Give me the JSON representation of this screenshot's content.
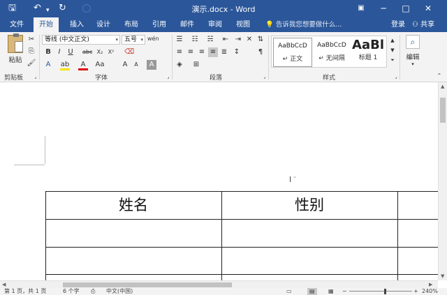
{
  "window": {
    "title": "演示.docx - Word"
  },
  "quick_access": {
    "save_icon": "save-icon",
    "undo_icon": "undo-icon",
    "redo_icon": "redo-icon"
  },
  "tabs": [
    "文件",
    "开始",
    "插入",
    "设计",
    "布局",
    "引用",
    "邮件",
    "审阅",
    "视图"
  ],
  "active_tab": "开始",
  "tell_me": "告诉我您想要做什么...",
  "account": {
    "login": "登录",
    "share": "共享"
  },
  "ribbon": {
    "clipboard": {
      "paste": "粘贴",
      "group": "剪贴板"
    },
    "font": {
      "name": "等线 (中文正文)",
      "size": "五号",
      "group": "字体",
      "buttons": [
        "B",
        "I",
        "U",
        "abc",
        "X₂",
        "X²",
        "A",
        "A",
        "Aa",
        "A",
        "A",
        "A"
      ]
    },
    "paragraph": {
      "group": "段落"
    },
    "styles": {
      "group": "样式",
      "items": [
        {
          "preview": "AaBbCcD",
          "name": "↵ 正文"
        },
        {
          "preview": "AaBbCcD",
          "name": "↵ 无间隔"
        },
        {
          "preview": "AaBl",
          "name": "标题 1"
        }
      ]
    },
    "editing": {
      "label": "编辑"
    }
  },
  "document": {
    "table": {
      "headers": [
        "姓名",
        "性别"
      ]
    }
  },
  "statusbar": {
    "page": "第 1 页，共 1 页",
    "words": "6 个字",
    "language": "中文(中国)",
    "zoom": "240%"
  },
  "colors": {
    "accent": "#2b579a",
    "ribbon_bg": "#f3f3f3"
  }
}
